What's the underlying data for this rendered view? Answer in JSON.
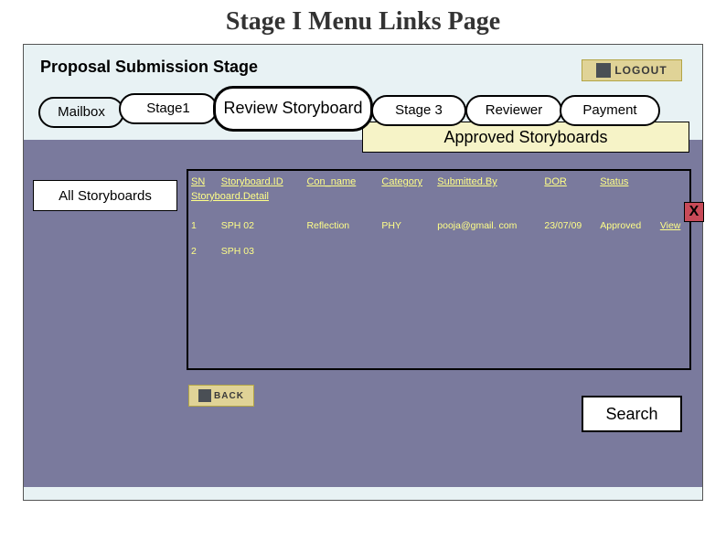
{
  "page_title": "Stage I Menu Links Page",
  "sub_title": "Proposal Submission Stage",
  "logout_label": "LOGOUT",
  "nav": {
    "mailbox": "Mailbox",
    "stage1": "Stage1",
    "review": "Review Storyboard",
    "stage3": "Stage 3",
    "reviewer": "Reviewer",
    "payment": "Payment"
  },
  "approved_banner": "Approved Storyboards",
  "side_button": "All Storyboards",
  "headers": {
    "sn": "SN",
    "sbid": "Storyboard.ID",
    "con": "Con_name",
    "cat": "Category",
    "subby": "Submitted.By",
    "dor": "DOR",
    "status": "Status",
    "sbdetail": "Storyboard.Detail"
  },
  "rows": [
    {
      "sn": "1",
      "sbid": "SPH 02",
      "con": "Reflection",
      "cat": "PHY",
      "subby": "pooja@gmail. com",
      "dor": "23/07/09",
      "status": "Approved",
      "view": "View"
    },
    {
      "sn": "2",
      "sbid": "SPH 03",
      "con": "",
      "cat": "",
      "subby": "",
      "dor": "",
      "status": "",
      "view": ""
    }
  ],
  "close_x": "X",
  "back_label": "BACK",
  "search_label": "Search"
}
